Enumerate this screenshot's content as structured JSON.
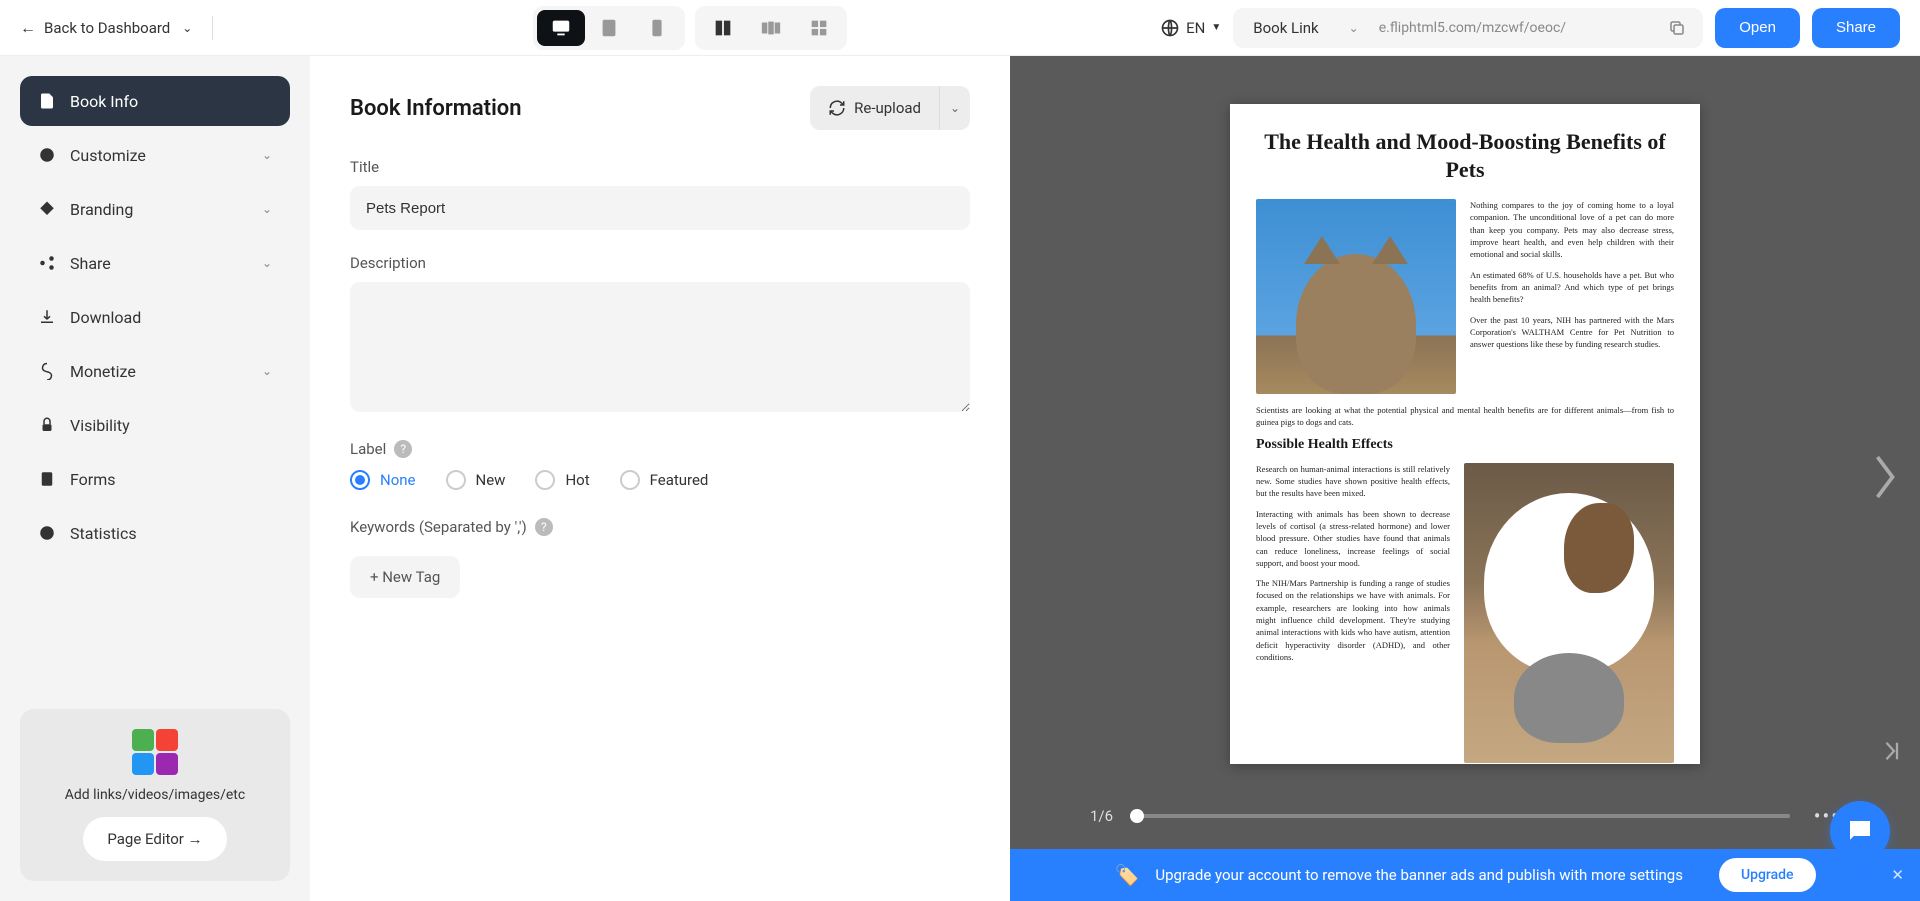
{
  "header": {
    "back_label": "Back to Dashboard",
    "lang": "EN",
    "link_label": "Book Link",
    "link_url": "e.fliphtml5.com/mzcwf/oeoc/",
    "open_label": "Open",
    "share_label": "Share"
  },
  "sidebar": {
    "items": [
      {
        "label": "Book Info",
        "icon": "file"
      },
      {
        "label": "Customize",
        "icon": "palette",
        "expandable": true
      },
      {
        "label": "Branding",
        "icon": "tag",
        "expandable": true
      },
      {
        "label": "Share",
        "icon": "share",
        "expandable": true
      },
      {
        "label": "Download",
        "icon": "download"
      },
      {
        "label": "Monetize",
        "icon": "money",
        "expandable": true
      },
      {
        "label": "Visibility",
        "icon": "lock"
      },
      {
        "label": "Forms",
        "icon": "form"
      },
      {
        "label": "Statistics",
        "icon": "chart"
      }
    ],
    "editor_text": "Add links/videos/images/etc",
    "editor_button": "Page Editor →"
  },
  "content": {
    "section_title": "Book Information",
    "reupload_label": "Re-upload",
    "title_label": "Title",
    "title_value": "Pets Report",
    "description_label": "Description",
    "description_value": "",
    "label_label": "Label",
    "label_options": [
      "None",
      "New",
      "Hot",
      "Featured"
    ],
    "label_selected": "None",
    "keywords_label": "Keywords (Separated by ',')",
    "new_tag_label": "+ New Tag"
  },
  "preview": {
    "page_counter": "1/6",
    "doc": {
      "title": "The Health and Mood-Boosting Benefits of Pets",
      "para1": "Nothing compares to the joy of coming home to a loyal companion. The unconditional love of a pet can do more than keep you company. Pets may also decrease stress, improve heart health, and even help children with their emotional and social skills.",
      "para2": "An estimated 68% of U.S. households have a pet. But who benefits from an animal? And which type of pet brings health benefits?",
      "para3": "Over the past 10 years, NIH has partnered with the Mars Corporation's WALTHAM Centre for Pet Nutrition to answer questions like these by funding research studies.",
      "para4": "Scientists are looking at what the potential physical and mental health benefits are for different animals—from fish to guinea pigs to dogs and cats.",
      "subtitle": "Possible Health Effects",
      "para5": "Research on human-animal interactions is still relatively new. Some studies have shown positive health effects, but the results have been mixed.",
      "para6": "Interacting with animals has been shown to decrease levels of cortisol (a stress-related hormone) and lower blood pressure. Other studies have found that animals can reduce loneliness, increase feelings of social support, and boost your mood.",
      "para7": "The NIH/Mars Partnership is funding a range of studies focused on the relationships we have with animals. For example, researchers are looking into how animals might influence child development. They're studying animal interactions with kids who have autism, attention deficit hyperactivity disorder (ADHD), and other conditions."
    }
  },
  "banner": {
    "text": "Upgrade your account to remove the banner ads and publish with more settings",
    "button": "Upgrade"
  }
}
